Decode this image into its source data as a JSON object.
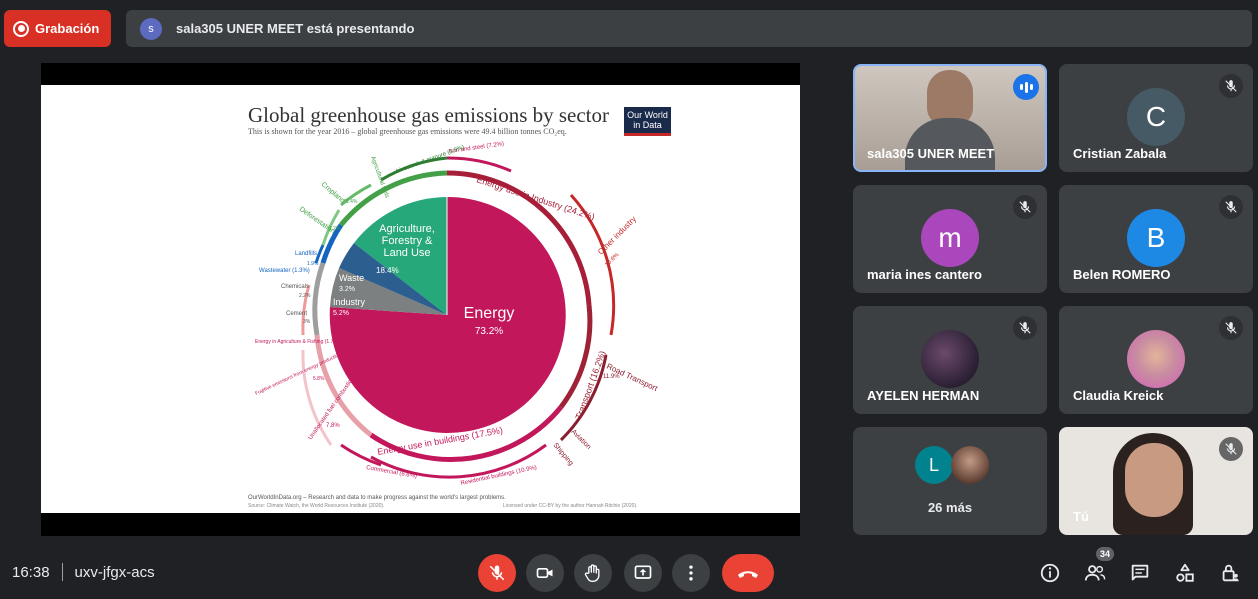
{
  "top_bar": {
    "recording_label": "Grabación",
    "presenter_initial": "s",
    "presenting_text": "sala305 UNER MEET está presentando"
  },
  "slide": {
    "title": "Global greenhouse gas emissions by sector",
    "subtitle": "This is shown for the year 2016 – global greenhouse gas emissions were 49.4 billion tonnes CO₂eq.",
    "logo": "Our World in Data",
    "footer_line": "OurWorldInData.org – Research and data to make progress against the world's largest problems.",
    "footer_source": "Source: Climate Watch, the World Resources Institute (2020).",
    "footer_license": "Licensed under CC-BY by the author Hannah Ritchie (2020).",
    "chart": {
      "center_labels": {
        "energy": "Energy",
        "energy_pct": "73.2%",
        "agri": "Agriculture, Forestry & Land Use",
        "agri_pct": "18.4%",
        "waste": "Waste",
        "waste_pct": "3.2%",
        "industry": "Industry",
        "industry_pct": "5.2%"
      },
      "ring_labels": {
        "industry_energy": "Energy use in Industry (24.2%)",
        "transport": "Transport (16.2%)",
        "buildings": "Energy use in buildings (17.5%)",
        "iron_steel": "Iron and steel (7.2%)",
        "other_industry": "Other industry",
        "other_industry_pct": "10.6%",
        "road_transport": "Road Transport",
        "road_transport_pct": "11.9%",
        "aviation": "Aviation",
        "shipping": "Shipping",
        "residential": "Residential buildings (10.9%)",
        "commercial": "Commercial (6.6%)",
        "unallocated": "Unallocated fuel combustion",
        "unallocated_pct": "7.8%",
        "fugitive": "Fugitive emissions from energy production",
        "fugitive_pct": "5.8%",
        "agri_fishing": "Energy in Agriculture & Fishing (1.7%)",
        "cement": "Cement",
        "cement_pct": "3%",
        "chemicals": "Chemicals",
        "chemicals_pct": "2.2%",
        "wastewater": "Wastewater (1.3%)",
        "landfills": "Landfills",
        "landfills_pct": "1.9%",
        "deforestation": "Deforestation",
        "deforestation_pct": "2.2%",
        "cropland": "Cropland",
        "cropland_pct": "1.4%",
        "livestock": "Livestock & manure (5.8%)",
        "agricultural_soils": "Agricultural soils"
      }
    }
  },
  "participants": [
    {
      "name": "sala305 UNER MEET",
      "speaking": true
    },
    {
      "name": "Cristian Zabala",
      "initial": "C",
      "color": "#455a64"
    },
    {
      "name": "maria ines cantero",
      "initial": "m",
      "color": "#ab47bc"
    },
    {
      "name": "Belen ROMERO",
      "initial": "B",
      "color": "#1e88e5"
    },
    {
      "name": "AYELEN HERMAN"
    },
    {
      "name": "Claudia Kreick"
    },
    {
      "name": "26 más",
      "initial": "L",
      "color": "#00838f"
    },
    {
      "name": "Tú"
    }
  ],
  "bottom_bar": {
    "time": "16:38",
    "meeting_code": "uxv-jfgx-acs",
    "people_count": "34"
  }
}
